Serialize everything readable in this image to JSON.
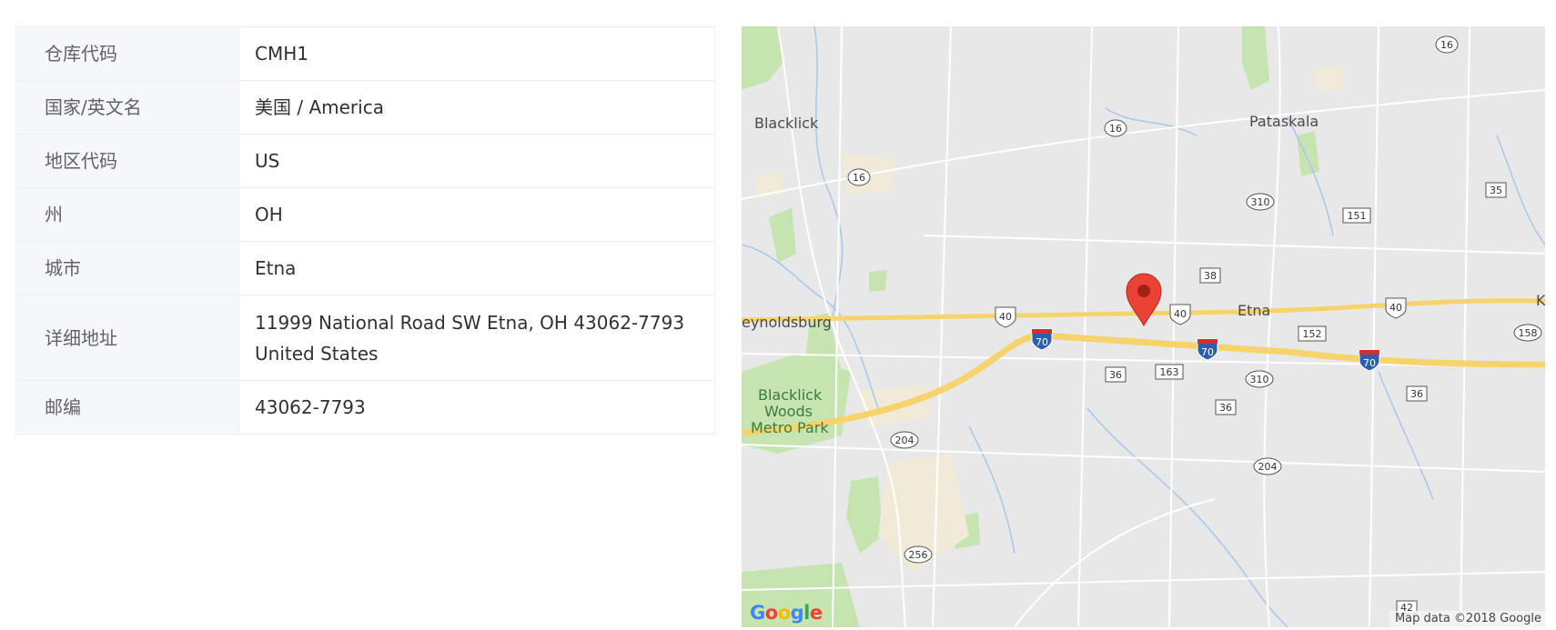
{
  "warehouse_info": {
    "rows": [
      {
        "label": "仓库代码",
        "value": "CMH1"
      },
      {
        "label": "国家/英文名",
        "value": "美国 / America"
      },
      {
        "label": "地区代码",
        "value": "US"
      },
      {
        "label": "州",
        "value": "OH"
      },
      {
        "label": "城市",
        "value": "Etna"
      },
      {
        "label": "详细地址",
        "value_line1": "11999 National Road SW Etna, OH 43062-7793",
        "value_line2": "United States"
      },
      {
        "label": "邮编",
        "value": "43062-7793"
      }
    ]
  },
  "map": {
    "places": {
      "blacklick": "Blacklick",
      "pataskala": "Pataskala",
      "reynoldsburg": "eynoldsburg",
      "etna": "Etna",
      "blacklick_woods_1": "Blacklick",
      "blacklick_woods_2": "Woods",
      "blacklick_woods_3": "Metro Park",
      "edge_k": "K"
    },
    "shields": {
      "s16a": "16",
      "s16b": "16",
      "s16c": "16",
      "s310a": "310",
      "s310b": "310",
      "s151": "151",
      "s35": "35",
      "s38": "38",
      "us40a": "40",
      "us40b": "40",
      "us40c": "40",
      "i70a": "70",
      "i70b": "70",
      "i70c": "70",
      "s152": "152",
      "s158": "158",
      "s36a": "36",
      "s36b": "36",
      "s36c": "36",
      "s163": "163",
      "s204a": "204",
      "s204b": "204",
      "s256": "256",
      "s42": "42"
    },
    "attribution": "Map data ©2018 Google",
    "logo": "Google",
    "marker_color": "#ea4335",
    "highway_color": "#f7d46b"
  }
}
